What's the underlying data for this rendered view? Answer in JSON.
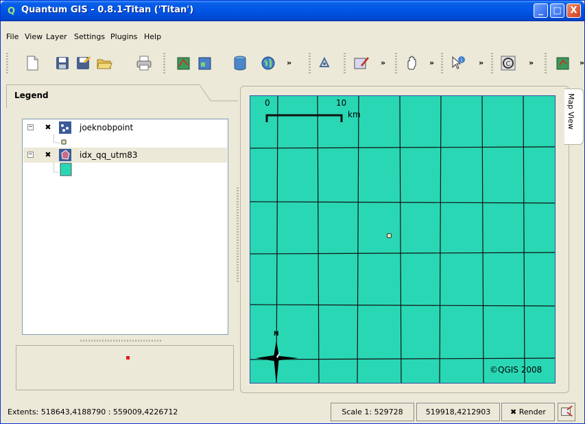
{
  "window": {
    "title": "Quantum GIS - 0.8.1-Titan ('Titan')"
  },
  "titlebar_buttons": {
    "minimize": "_",
    "maximize": "□",
    "close": "X"
  },
  "menu": [
    "File",
    "View",
    "Layer",
    "Settings",
    "Plugins",
    "Help"
  ],
  "toolbar": {
    "overflow": "»",
    "tools": [
      "new-project-icon",
      "save-project-icon",
      "save-as-icon",
      "open-project-icon",
      "print-icon",
      "add-vector-layer-icon",
      "add-raster-layer-icon",
      "add-postgis-layer-icon",
      "add-wms-layer-icon",
      "capture-icon",
      "digitize-icon",
      "pan-icon",
      "identify-icon",
      "copyright-icon",
      "plugin-icon"
    ]
  },
  "legend": {
    "title": "Legend",
    "layers": [
      {
        "name": "joeknobpoint",
        "checked": "✖",
        "expander": "−",
        "selected": false
      },
      {
        "name": "idx_qq_utm83",
        "checked": "✖",
        "expander": "−",
        "selected": true
      }
    ],
    "symbol_colors": {
      "point": "#e8e0b0",
      "polygon": "#2ad7b4"
    }
  },
  "map": {
    "tab_label": "Map View",
    "background": "#2ad7b4",
    "scale_bar": {
      "start": "0",
      "end": "10",
      "unit": "km"
    },
    "north_label": "N",
    "copyright": "©QGIS 2008"
  },
  "status": {
    "extents": "Extents: 518643,4188790 : 559009,4226712",
    "scale": "Scale 1: 529728",
    "coords": "519918,4212903",
    "render_check": "✖",
    "render_label": "Render"
  }
}
